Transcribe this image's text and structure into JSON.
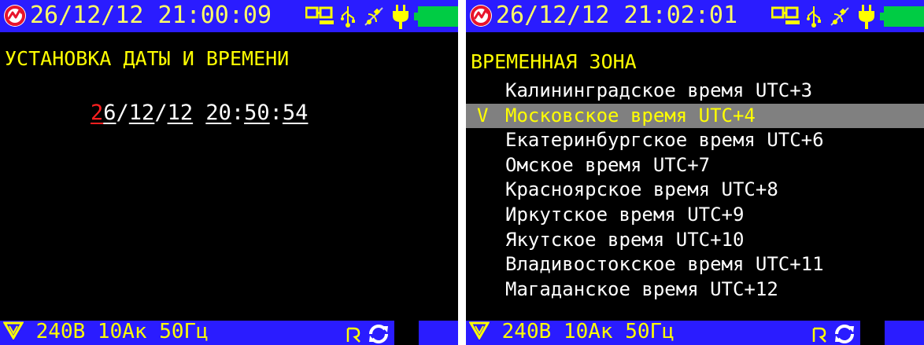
{
  "left_screen": {
    "datetime": "26/12/12 21:00:09",
    "title": "УСТАНОВКА ДАТЫ И ВРЕМЕНИ",
    "clock": {
      "day_tens": "2",
      "day_units": "6",
      "sep1": "/",
      "month": "12",
      "sep2": "/",
      "year": "12",
      "space": " ",
      "hours": "20",
      "colon1": ":",
      "minutes": "50",
      "colon2": ":",
      "seconds": "54"
    },
    "status": "240В 10Ак 50Гц"
  },
  "right_screen": {
    "datetime": "26/12/12 21:02:01",
    "title": "ВРЕМЕННАЯ ЗОНА",
    "selected_mark": "V",
    "timezones": [
      {
        "label": "Калининградское время UTC+3",
        "selected": false
      },
      {
        "label": "Московское время UTC+4",
        "selected": true
      },
      {
        "label": "Екатеринбургское время UTC+6",
        "selected": false
      },
      {
        "label": "Омское время UTC+7",
        "selected": false
      },
      {
        "label": "Красноярское время UTC+8",
        "selected": false
      },
      {
        "label": "Иркутское время UTC+9",
        "selected": false
      },
      {
        "label": "Якутское время UTC+10",
        "selected": false
      },
      {
        "label": "Владивостокское время UTC+11",
        "selected": false
      },
      {
        "label": "Магаданское время UTC+12",
        "selected": false
      }
    ],
    "status": "240В 10Ак 50Гц"
  },
  "icons": [
    "logo-icon",
    "computer-link-icon",
    "usb-icon",
    "gps-off-icon",
    "power-plug-icon",
    "battery-icon",
    "signal-icon",
    "sync-icon"
  ],
  "colors": {
    "bar_background": "#2a1cff",
    "screen_background": "#000000",
    "title_text": "#ffff00",
    "value_text": "#ffffff",
    "highlight": "#808080",
    "editing_digit": "#ff2020",
    "battery": "#00cc44"
  }
}
